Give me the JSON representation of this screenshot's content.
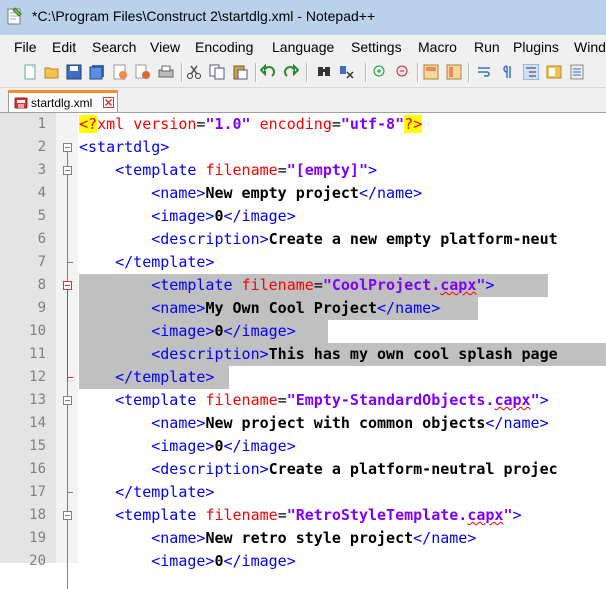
{
  "window": {
    "title": "*C:\\Program Files\\Construct 2\\startdlg.xml - Notepad++"
  },
  "menu": [
    "File",
    "Edit",
    "Search",
    "View",
    "Encoding",
    "Language",
    "Settings",
    "Macro",
    "Run",
    "Plugins",
    "Wind"
  ],
  "tab": {
    "label": "startdlg.xml"
  },
  "colors": {
    "tag": "#0000ff",
    "attribute": "#ff0000",
    "string": "#8000ff",
    "selection": "#c0c0c0",
    "tab_accent": "#fa8c28"
  },
  "lines": [
    {
      "n": "1",
      "parts": [
        [
          "pi",
          "<?"
        ],
        [
          "pitag",
          "xml "
        ],
        [
          "attr",
          "version"
        ],
        [
          "eq",
          "="
        ],
        [
          "str",
          "\"1.0\""
        ],
        [
          "eq",
          " "
        ],
        [
          "attr",
          "encoding"
        ],
        [
          "eq",
          "="
        ],
        [
          "str",
          "\"utf-8\""
        ],
        [
          "pi",
          "?>"
        ]
      ]
    },
    {
      "n": "2",
      "parts": [
        [
          "tag",
          "<startdlg>"
        ]
      ]
    },
    {
      "n": "3",
      "parts": [
        [
          "sp",
          "    "
        ],
        [
          "tag",
          "<template "
        ],
        [
          "attr",
          "filename"
        ],
        [
          "eq",
          "="
        ],
        [
          "str",
          "\"[empty]\""
        ],
        [
          "tag",
          ">"
        ]
      ]
    },
    {
      "n": "4",
      "parts": [
        [
          "sp",
          "        "
        ],
        [
          "tag",
          "<name>"
        ],
        [
          "text",
          "New empty project"
        ],
        [
          "tag",
          "</name>"
        ]
      ]
    },
    {
      "n": "5",
      "parts": [
        [
          "sp",
          "        "
        ],
        [
          "tag",
          "<image>"
        ],
        [
          "text",
          "0"
        ],
        [
          "tag",
          "</image>"
        ]
      ]
    },
    {
      "n": "6",
      "parts": [
        [
          "sp",
          "        "
        ],
        [
          "tag",
          "<description>"
        ],
        [
          "text",
          "Create a new empty platform-neut"
        ]
      ]
    },
    {
      "n": "7",
      "parts": [
        [
          "sp",
          "    "
        ],
        [
          "tag",
          "</template>"
        ]
      ]
    },
    {
      "n": "8",
      "parts": [
        [
          "sp",
          "        "
        ],
        [
          "tag",
          "<template "
        ],
        [
          "attr",
          "filename"
        ],
        [
          "eq",
          "="
        ],
        [
          "str",
          "\"CoolProject."
        ],
        [
          "strsq",
          "capx"
        ],
        [
          "str",
          "\""
        ],
        [
          "tag",
          ">"
        ]
      ]
    },
    {
      "n": "9",
      "parts": [
        [
          "sp",
          "        "
        ],
        [
          "tag",
          "<name>"
        ],
        [
          "text",
          "My Own Cool Project"
        ],
        [
          "tag",
          "</name>"
        ]
      ]
    },
    {
      "n": "10",
      "parts": [
        [
          "sp",
          "        "
        ],
        [
          "tag",
          "<image>"
        ],
        [
          "text",
          "0"
        ],
        [
          "tag",
          "</image>"
        ]
      ]
    },
    {
      "n": "11",
      "parts": [
        [
          "sp",
          "        "
        ],
        [
          "tag",
          "<description>"
        ],
        [
          "text",
          "This has my own cool splash page"
        ]
      ]
    },
    {
      "n": "12",
      "parts": [
        [
          "sp",
          "    "
        ],
        [
          "tag",
          "</template>"
        ]
      ]
    },
    {
      "n": "13",
      "parts": [
        [
          "sp",
          "    "
        ],
        [
          "tag",
          "<template "
        ],
        [
          "attr",
          "filename"
        ],
        [
          "eq",
          "="
        ],
        [
          "str",
          "\"Empty-StandardObjects."
        ],
        [
          "strsq",
          "capx"
        ],
        [
          "str",
          "\""
        ],
        [
          "tag",
          ">"
        ]
      ]
    },
    {
      "n": "14",
      "parts": [
        [
          "sp",
          "        "
        ],
        [
          "tag",
          "<name>"
        ],
        [
          "text",
          "New project with common objects"
        ],
        [
          "tag",
          "</name>"
        ]
      ]
    },
    {
      "n": "15",
      "parts": [
        [
          "sp",
          "        "
        ],
        [
          "tag",
          "<image>"
        ],
        [
          "text",
          "0"
        ],
        [
          "tag",
          "</image>"
        ]
      ]
    },
    {
      "n": "16",
      "parts": [
        [
          "sp",
          "        "
        ],
        [
          "tag",
          "<description>"
        ],
        [
          "text",
          "Create a platform-neutral projec"
        ]
      ]
    },
    {
      "n": "17",
      "parts": [
        [
          "sp",
          "    "
        ],
        [
          "tag",
          "</template>"
        ]
      ]
    },
    {
      "n": "18",
      "parts": [
        [
          "sp",
          "    "
        ],
        [
          "tag",
          "<template "
        ],
        [
          "attr",
          "filename"
        ],
        [
          "eq",
          "="
        ],
        [
          "str",
          "\"RetroStyleTemplate."
        ],
        [
          "strsq",
          "capx"
        ],
        [
          "str",
          "\""
        ],
        [
          "tag",
          ">"
        ]
      ]
    },
    {
      "n": "19",
      "parts": [
        [
          "sp",
          "        "
        ],
        [
          "tag",
          "<name>"
        ],
        [
          "text",
          "New retro style project"
        ],
        [
          "tag",
          "</name>"
        ]
      ]
    },
    {
      "n": "20",
      "parts": [
        [
          "sp",
          "        "
        ],
        [
          "tag",
          "<image>"
        ],
        [
          "text",
          "0"
        ],
        [
          "tag",
          "</image>"
        ]
      ]
    }
  ],
  "toolbar_icons": [
    "new-file-icon",
    "open-file-icon",
    "save-icon",
    "save-all-icon",
    "close-icon",
    "close-all-icon",
    "print-icon",
    "cut-icon",
    "copy-icon",
    "paste-icon",
    "undo-icon",
    "redo-icon",
    "find-icon",
    "replace-icon",
    "zoom-in-icon",
    "zoom-out-icon",
    "sync-vertical-icon",
    "sync-horizontal-icon",
    "word-wrap-icon",
    "show-all-chars-icon",
    "indent-guide-icon",
    "doc-map-icon",
    "function-list-icon"
  ]
}
